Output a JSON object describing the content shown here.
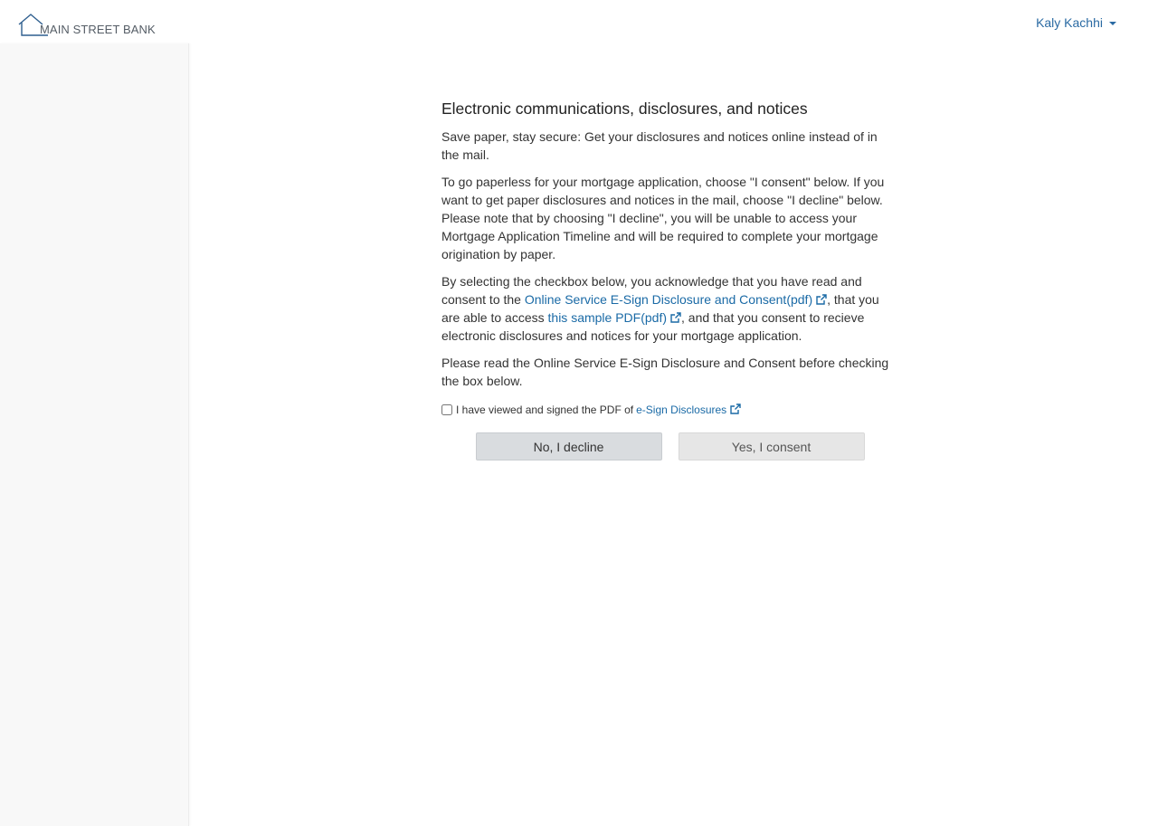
{
  "header": {
    "logo_text": "MAIN STREET BANK",
    "user_name": "Kaly Kachhi"
  },
  "main": {
    "title": "Electronic communications, disclosures, and notices",
    "para1": "Save paper, stay secure: Get your disclosures and notices online instead of in the mail.",
    "para2": "To go paperless for your mortgage application, choose \"I consent\" below. If you want to get paper disclosures and notices in the mail, choose \"I decline\" below. Please note that by choosing \"I decline\", you will be unable to access your Mortgage Application Timeline and will be required to complete your mortgage origination by paper.",
    "para3_part1": "By selecting the checkbox below, you acknowledge that you have read and consent to the ",
    "para3_link1": "Online Service E-Sign Disclosure and Consent(pdf)",
    "para3_part2": ", that you are able to access ",
    "para3_link2": "this sample PDF(pdf)",
    "para3_part3": ", and that you consent to recieve electronic disclosures and notices for your mortgage application.",
    "para4": "Please read the Online Service E-Sign Disclosure and Consent before checking the box below.",
    "checkbox_label": "I have viewed and signed the PDF of ",
    "checkbox_link": "e-Sign Disclosures",
    "decline_button": "No, I decline",
    "consent_button": "Yes, I consent"
  },
  "colors": {
    "link": "#1a6aa6",
    "sidebar_bg": "#f8f8f8",
    "decline_bg": "#d9dcdf",
    "consent_bg": "#e6e6e6"
  }
}
